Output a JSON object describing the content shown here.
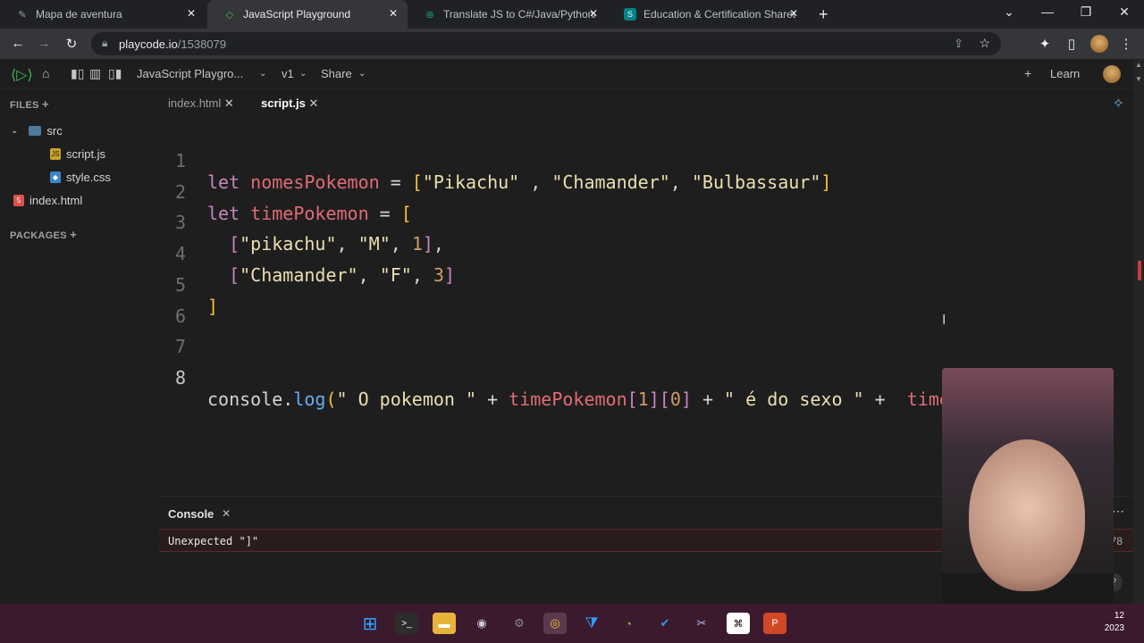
{
  "browser": {
    "tabs": [
      {
        "title": "Mapa de aventura",
        "active": false
      },
      {
        "title": "JavaScript Playground",
        "active": true
      },
      {
        "title": "Translate JS to C#/Java/Python/R",
        "active": false
      },
      {
        "title": "Education & Certification Shared",
        "active": false
      }
    ],
    "url_host": "playcode.io",
    "url_path": "/1538079"
  },
  "app": {
    "project_title": "JavaScript Playgro...",
    "version": "v1",
    "share_label": "Share",
    "learn_label": "Learn"
  },
  "sidebar": {
    "files_header": "FILES",
    "packages_header": "PACKAGES",
    "folder": "src",
    "files": [
      "script.js",
      "style.css"
    ],
    "root_file": "index.html"
  },
  "editor": {
    "tabs": [
      {
        "label": "index.html",
        "active": false
      },
      {
        "label": "script.js",
        "active": true
      }
    ],
    "line_numbers": [
      "1",
      "2",
      "3",
      "4",
      "5",
      "6",
      "7",
      "8"
    ]
  },
  "console": {
    "title": "Console",
    "error": "Unexpected \"]\"",
    "position": ":78"
  },
  "taskbar": {
    "time": "12",
    "date": "2023"
  },
  "colors": {
    "keyword": "#c586c0",
    "variable": "#e06c75",
    "string": "#ecdfb0",
    "number": "#d19a66",
    "bracket": "#f1c232",
    "function": "#61afef"
  }
}
